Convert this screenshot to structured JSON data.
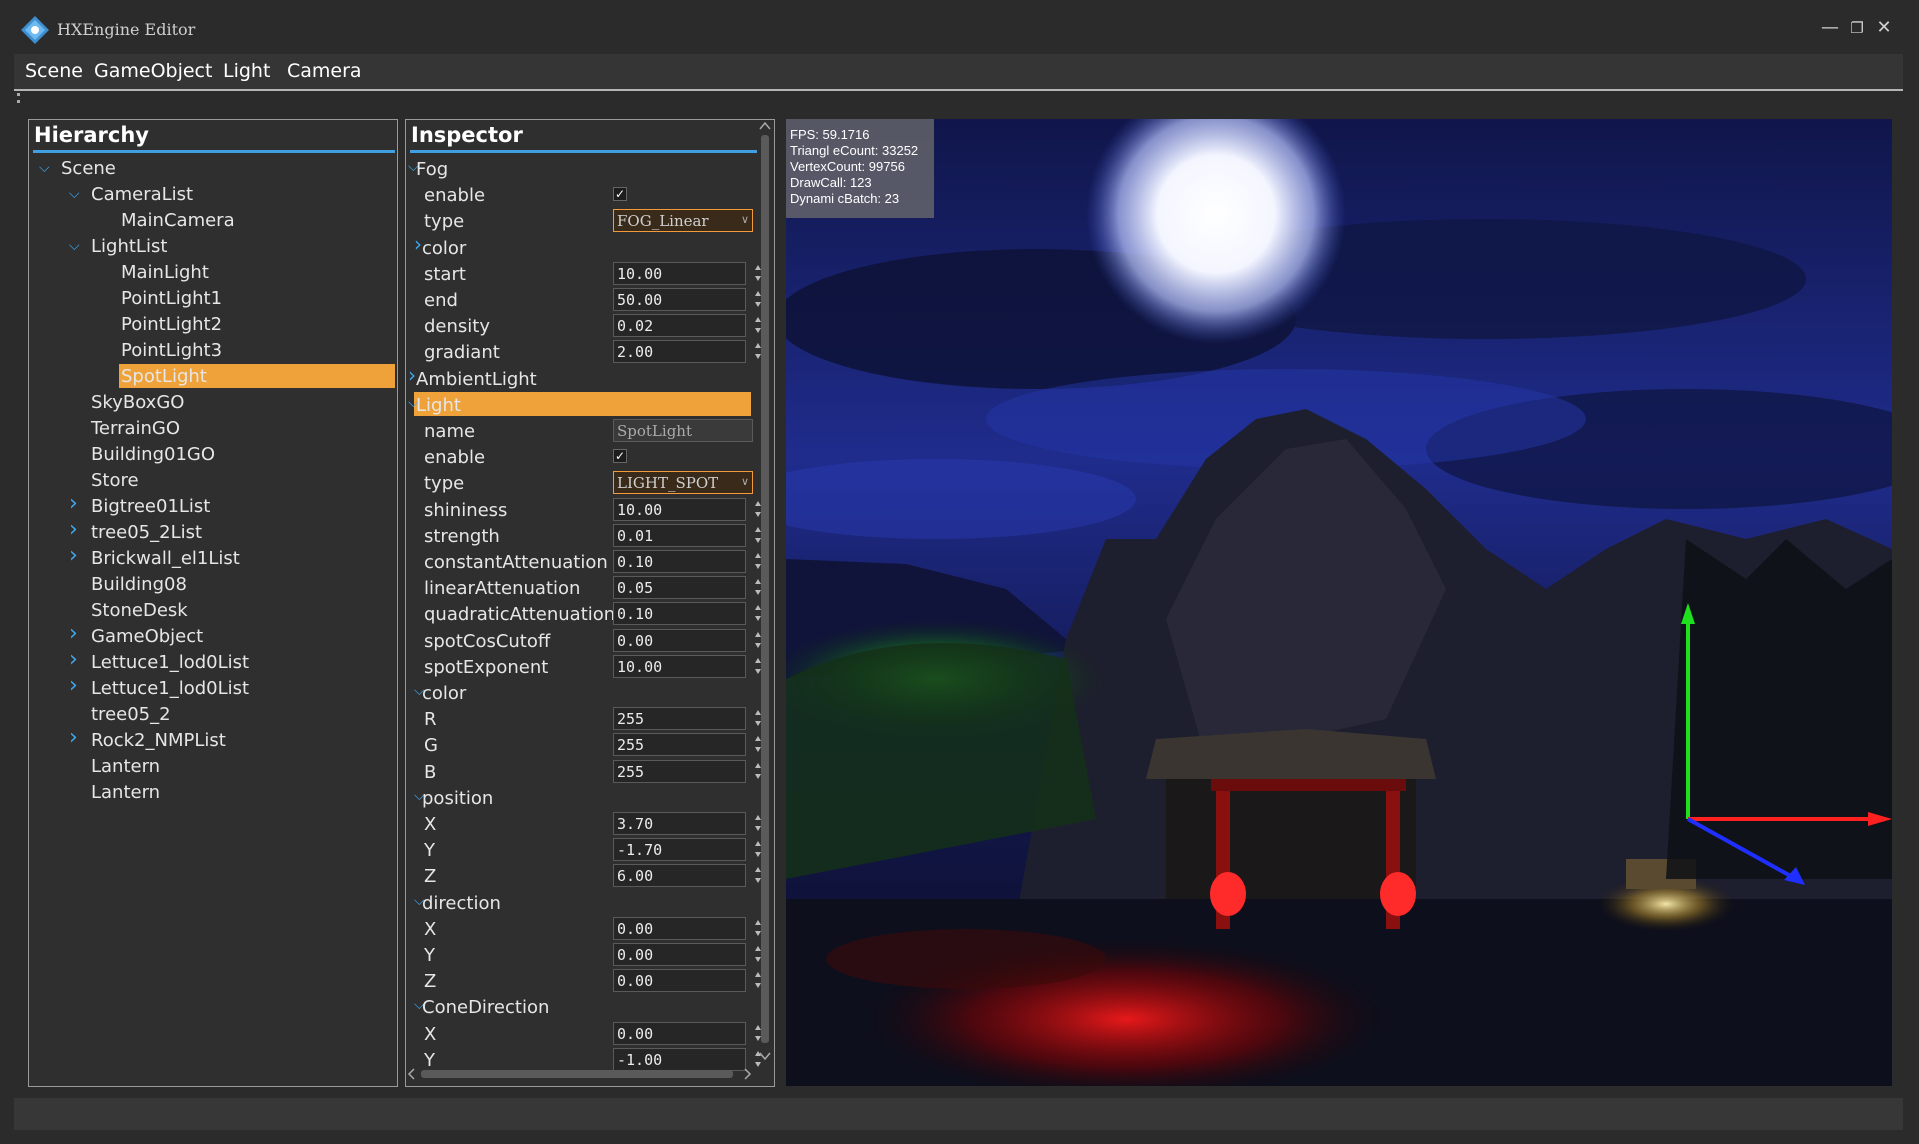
{
  "window": {
    "title": "HXEngine Editor"
  },
  "menu": [
    "Scene",
    "GameObject",
    "Light",
    "Camera"
  ],
  "hierarchy": {
    "title": "Hierarchy",
    "items": [
      {
        "label": "Scene",
        "expanded": true
      },
      {
        "label": "CameraList",
        "expanded": true
      },
      {
        "label": "MainCamera"
      },
      {
        "label": "LightList",
        "expanded": true
      },
      {
        "label": "MainLight"
      },
      {
        "label": "PointLight1"
      },
      {
        "label": "PointLight2"
      },
      {
        "label": "PointLight3"
      },
      {
        "label": "SpotLight",
        "selected": true
      },
      {
        "label": "SkyBoxGO"
      },
      {
        "label": "TerrainGO"
      },
      {
        "label": "Building01GO"
      },
      {
        "label": "Store"
      },
      {
        "label": "Bigtree01List",
        "expanded": false
      },
      {
        "label": "tree05_2List",
        "expanded": false
      },
      {
        "label": "Brickwall_el1List",
        "expanded": false
      },
      {
        "label": "Building08"
      },
      {
        "label": "StoneDesk"
      },
      {
        "label": "GameObject",
        "expanded": false
      },
      {
        "label": "Lettuce1_lod0List",
        "expanded": false
      },
      {
        "label": "Lettuce1_lod0List",
        "expanded": false
      },
      {
        "label": "tree05_2"
      },
      {
        "label": "Rock2_NMPList",
        "expanded": false
      },
      {
        "label": "Lantern"
      },
      {
        "label": "Lantern"
      }
    ]
  },
  "inspector": {
    "title": "Inspector",
    "rows": [
      {
        "kind": "group",
        "label": "Fog",
        "open": true
      },
      {
        "kind": "check",
        "label": "enable",
        "checked": true
      },
      {
        "kind": "combo",
        "label": "type",
        "value": "FOG_Linear"
      },
      {
        "kind": "subgroup",
        "label": "color",
        "open": false
      },
      {
        "kind": "num",
        "label": "start",
        "value": "10.00"
      },
      {
        "kind": "num",
        "label": "end",
        "value": "50.00"
      },
      {
        "kind": "num",
        "label": "density",
        "value": "0.02"
      },
      {
        "kind": "num",
        "label": "gradiant",
        "value": "2.00"
      },
      {
        "kind": "group",
        "label": "AmbientLight",
        "open": false
      },
      {
        "kind": "group",
        "label": "Light",
        "open": true,
        "selected": true
      },
      {
        "kind": "text",
        "label": "name",
        "value": "SpotLight"
      },
      {
        "kind": "check",
        "label": "enable",
        "checked": true
      },
      {
        "kind": "combo",
        "label": "type",
        "value": "LIGHT_SPOT"
      },
      {
        "kind": "num",
        "label": "shininess",
        "value": "10.00"
      },
      {
        "kind": "num",
        "label": "strength",
        "value": "0.01"
      },
      {
        "kind": "num",
        "label": "constantAttenuation",
        "value": "0.10"
      },
      {
        "kind": "num",
        "label": "linearAttenuation",
        "value": "0.05"
      },
      {
        "kind": "num",
        "label": "quadraticAttenuation",
        "value": "0.10"
      },
      {
        "kind": "num",
        "label": "spotCosCutoff",
        "value": "0.00"
      },
      {
        "kind": "num",
        "label": "spotExponent",
        "value": "10.00"
      },
      {
        "kind": "subgroup",
        "label": "color",
        "open": true
      },
      {
        "kind": "num",
        "label": "R",
        "value": "255"
      },
      {
        "kind": "num",
        "label": "G",
        "value": "255"
      },
      {
        "kind": "num",
        "label": "B",
        "value": "255"
      },
      {
        "kind": "subgroup",
        "label": "position",
        "open": true
      },
      {
        "kind": "num",
        "label": "X",
        "value": "3.70"
      },
      {
        "kind": "num",
        "label": "Y",
        "value": "-1.70"
      },
      {
        "kind": "num",
        "label": "Z",
        "value": "6.00"
      },
      {
        "kind": "subgroup",
        "label": "direction",
        "open": true
      },
      {
        "kind": "num",
        "label": "X",
        "value": "0.00"
      },
      {
        "kind": "num",
        "label": "Y",
        "value": "0.00"
      },
      {
        "kind": "num",
        "label": "Z",
        "value": "0.00"
      },
      {
        "kind": "subgroup",
        "label": "ConeDirection",
        "open": true
      },
      {
        "kind": "num",
        "label": "X",
        "value": "0.00"
      },
      {
        "kind": "num",
        "label": "Y",
        "value": "-1.00"
      }
    ]
  },
  "stats": {
    "fps": "FPS: 59.1716",
    "triangles": "Triangl eCount: 33252",
    "vertices": "VertexCount: 99756",
    "drawcalls": "DrawCall: 123",
    "batch": "Dynami cBatch: 23"
  },
  "colors": {
    "accent": "#3f9fe0",
    "selection": "#f0a23a",
    "background": "#2b2b2b"
  },
  "icons": {
    "app": "hxengine-logo-icon",
    "minimize": "minimize-icon",
    "restore": "restore-icon",
    "close": "close-icon"
  }
}
